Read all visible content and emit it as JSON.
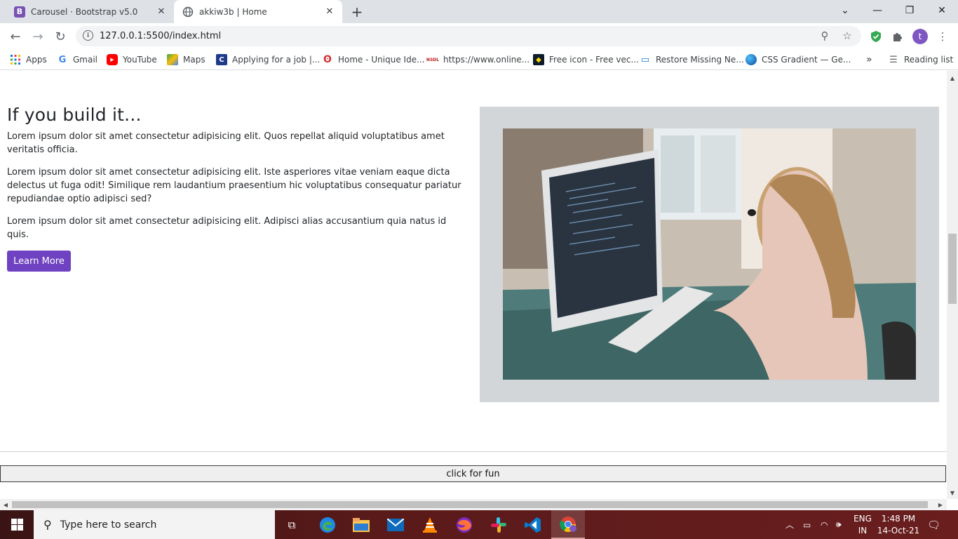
{
  "browser": {
    "tabs": [
      {
        "title": "Carousel · Bootstrap v5.0",
        "favicon_letter": "B",
        "favicon_color": "#7952b3"
      },
      {
        "title": "akkiw3b | Home",
        "favicon_letter": "",
        "favicon_color": "#5f6368"
      }
    ],
    "url": "127.0.0.1:5500/index.html",
    "profile_initial": "t",
    "bookmarks": [
      {
        "label": "Apps"
      },
      {
        "label": "Gmail"
      },
      {
        "label": "YouTube"
      },
      {
        "label": "Maps"
      },
      {
        "label": "Applying for a job |..."
      },
      {
        "label": "Home - Unique Ide..."
      },
      {
        "label": "https://www.online..."
      },
      {
        "label": "Free icon - Free vec..."
      },
      {
        "label": "Restore Missing Ne..."
      },
      {
        "label": "CSS Gradient — Ge..."
      }
    ],
    "bookmark_overflow": "»",
    "reading_list": "Reading list"
  },
  "page": {
    "heading": "If you build it...",
    "paragraphs": [
      "Lorem ipsum dolor sit amet consectetur adipisicing elit. Quos repellat aliquid voluptatibus amet veritatis officia.",
      "Lorem ipsum dolor sit amet consectetur adipisicing elit. Iste asperiores vitae veniam eaque dicta delectus ut fuga odit! Similique rem laudantium praesentium hic voluptatibus consequatur pariatur repudiandae optio adipisci sed?",
      "Lorem ipsum dolor sit amet consectetur adipisicing elit. Adipisci alias accusantium quia natus id quis."
    ],
    "learn_more": "Learn More",
    "fun_button": "click for fun",
    "accent_color": "#6f42c1"
  },
  "taskbar": {
    "search_placeholder": "Type here to search",
    "lang_top": "ENG",
    "lang_bottom": "IN",
    "time": "1:48 PM",
    "date": "14-Oct-21"
  }
}
